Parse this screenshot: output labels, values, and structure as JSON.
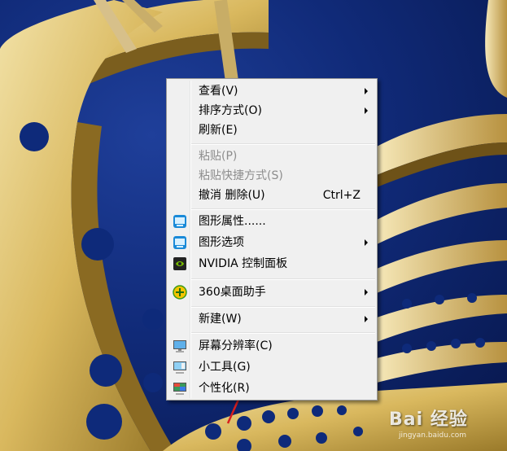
{
  "menu": {
    "items": [
      {
        "label": "查看(V)",
        "submenu": true
      },
      {
        "label": "排序方式(O)",
        "submenu": true
      },
      {
        "label": "刷新(E)"
      },
      {
        "label": "粘贴(P)",
        "disabled": true
      },
      {
        "label": "粘贴快捷方式(S)",
        "disabled": true
      },
      {
        "label": "撤消 删除(U)",
        "accel": "Ctrl+Z"
      },
      {
        "label": "图形属性......",
        "icon": "intel-graphics-icon"
      },
      {
        "label": "图形选项",
        "icon": "intel-graphics-icon",
        "submenu": true
      },
      {
        "label": "NVIDIA 控制面板",
        "icon": "nvidia-icon"
      },
      {
        "label": "360桌面助手",
        "icon": "360-plus-icon",
        "submenu": true
      },
      {
        "label": "新建(W)",
        "submenu": true
      },
      {
        "label": "屏幕分辨率(C)",
        "icon": "monitor-icon"
      },
      {
        "label": "小工具(G)",
        "icon": "gadgets-icon"
      },
      {
        "label": "个性化(R)",
        "icon": "personalize-icon"
      }
    ]
  },
  "watermark": {
    "text": "Bai 经验",
    "sub": "jingyan.baidu.com"
  },
  "colors": {
    "menu_bg": "#f0f0f0",
    "disabled_text": "#8d8d8d",
    "desktop_blue": "#102a78",
    "arrow_red": "#d81e1e"
  }
}
